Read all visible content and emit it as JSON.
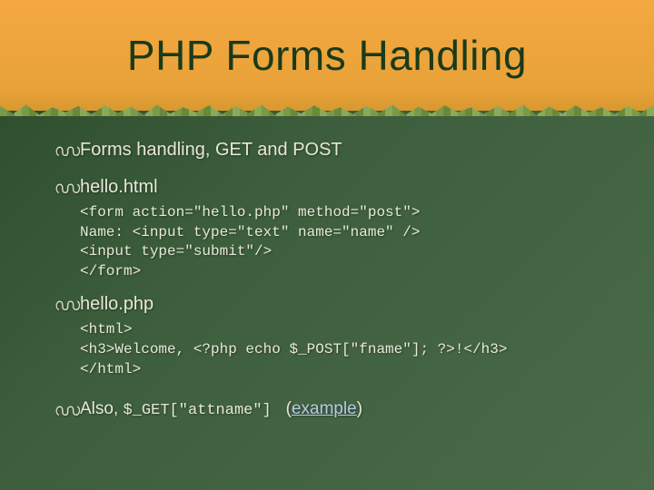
{
  "slide": {
    "title": "PHP Forms Handling",
    "bullets": {
      "b1": "Forms handling, GET and POST",
      "b2": "hello.html",
      "code1": "<form action=\"hello.php\" method=\"post\">\nName: <input type=\"text\" name=\"name\" />\n<input type=\"submit\"/>\n</form>",
      "b3": "hello.php",
      "code2": "<html>\n<h3>Welcome, <?php echo $_POST[\"fname\"]; ?>!</h3>\n</html>",
      "b4_prefix": "Also, ",
      "b4_code": "$_GET[\"attname\"]",
      "b4_paren_open": "(",
      "b4_link": "example",
      "b4_paren_close": ")"
    }
  }
}
